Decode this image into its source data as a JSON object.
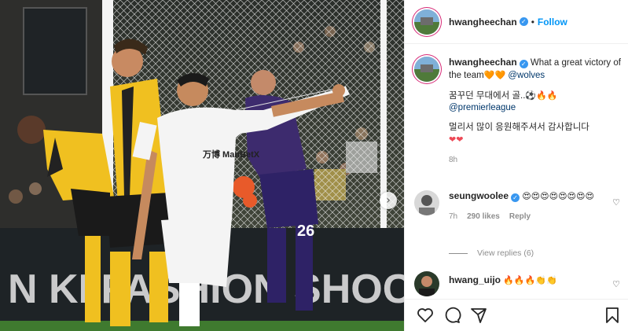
{
  "post": {
    "author": "hwangheechan",
    "follow_label": "Follow",
    "dot": "•",
    "caption": {
      "line1": "What a great victory of the team",
      "hearts": "🧡🧡",
      "mention": "@wolves",
      "line2": "꿈꾸던 무대에서 골..",
      "line2_emoji": "⚽🔥🔥",
      "mention2": "@premierleague",
      "line3": "멀리서 많이 응원해주셔서 감사합니다",
      "line3_emoji": "❤❤",
      "time": "8h"
    }
  },
  "comments": [
    {
      "user": "seungwoolee",
      "text": "😍😍😍😍😍😍😍😍",
      "time": "7h",
      "likes": "290 likes",
      "reply": "Reply"
    },
    {
      "user": "hwang_uijo",
      "text": "🔥🔥🔥👏👏"
    }
  ],
  "view_replies": "View replies (6)",
  "photo": {
    "jersey_number_gk": "26",
    "banner_text": "N KI   FASHION SHOCK",
    "shirt_sponsor": "万博 ManBetX"
  },
  "icons": {
    "next": "chevron-right-icon",
    "like": "heart-icon",
    "comment": "comment-icon",
    "share": "paper-plane-icon",
    "save": "bookmark-icon"
  },
  "colors": {
    "link": "#00376b",
    "follow": "#0095f6",
    "verified": "#3897f0",
    "wolves_orange": "#f2a900"
  }
}
